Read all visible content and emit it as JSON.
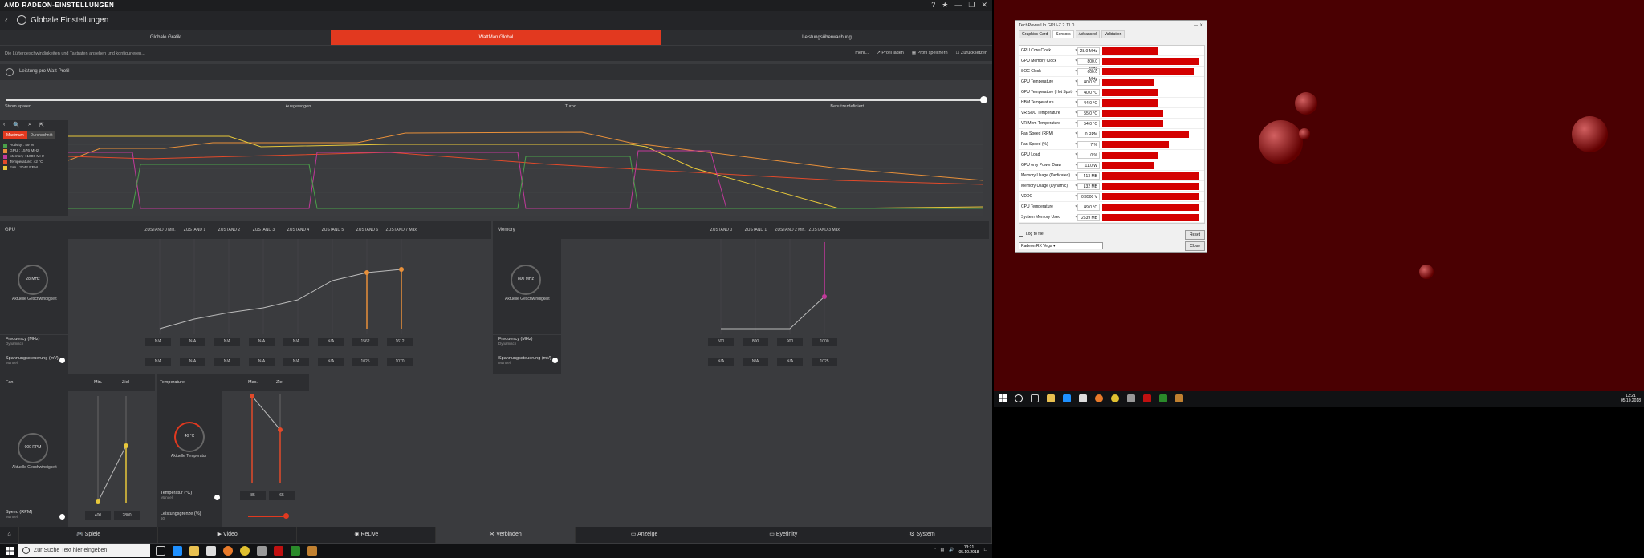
{
  "radeon": {
    "brand": "AMD RADEON-EINSTELLUNGEN",
    "title": "Globale Einstellungen",
    "tabs": [
      "Globale Grafik",
      "WattMan Global",
      "Leistungsüberwachung"
    ],
    "description": "Die Lüftergeschwindigkeiten und Taktraten ansehen und konfigurieren...",
    "actions": [
      "mehr...",
      "Profil laden",
      "Profil speichern",
      "Zurücksetzen"
    ],
    "profile_label": "Leistung pro Watt-Profil",
    "preset_labels": [
      "Strom sparen",
      "Ausgewogen",
      "Turbo",
      "Benutzerdefiniert"
    ],
    "graph_buttons": [
      "Maximum",
      "Durchschnitt"
    ],
    "legend": [
      {
        "label": "Activity : 49 %",
        "color": "#4aa04a"
      },
      {
        "label": "GPU : 1576 MHz",
        "color": "#e8903a"
      },
      {
        "label": "Memory : 1000 MHz",
        "color": "#c0399a"
      },
      {
        "label": "Temperature: 42 °C",
        "color": "#e24a2a"
      },
      {
        "label": "Fan : 3042 RPM",
        "color": "#e8c83a"
      }
    ],
    "gpu": {
      "section": "GPU",
      "states": [
        "ZUSTAND 0 Min.",
        "ZUSTAND 1",
        "ZUSTAND 2",
        "ZUSTAND 3",
        "ZUSTAND 4",
        "ZUSTAND 5",
        "ZUSTAND 6",
        "ZUSTAND 7 Max."
      ],
      "gauge": "28 MHz",
      "gauge_label": "Aktuelle Geschwindigkeit",
      "freq_label": "Frequency (MHz)",
      "freq_sub": "Dynamisch",
      "freq_values": [
        "N/A",
        "N/A",
        "N/A",
        "N/A",
        "N/A",
        "N/A",
        "1562",
        "1612"
      ],
      "volt_label": "Spannungssteuerung (mV)",
      "volt_sub": "Manuell",
      "volt_values": [
        "N/A",
        "N/A",
        "N/A",
        "N/A",
        "N/A",
        "N/A",
        "1025",
        "1070"
      ]
    },
    "memory": {
      "section": "Memory",
      "states": [
        "ZUSTAND 0",
        "ZUSTAND 1",
        "ZUSTAND 2 Min.",
        "ZUSTAND 3 Max."
      ],
      "gauge": "800 MHz",
      "gauge_label": "Aktuelle Geschwindigkeit",
      "freq_label": "Frequency (MHz)",
      "freq_sub": "Dynamisch",
      "freq_values": [
        "500",
        "800",
        "900",
        "1000"
      ],
      "volt_label": "Spannungssteuerung (mV)",
      "volt_sub": "Manuell",
      "volt_values": [
        "N/A",
        "N/A",
        "N/A",
        "1025"
      ]
    },
    "fan": {
      "section": "Fan",
      "cols": [
        "Min.",
        "Ziel"
      ],
      "gauge": "000 RPM",
      "gauge_label": "Aktuelle Geschwindigkeit",
      "speed_label": "Speed (RPM)",
      "speed_sub": "Manuell",
      "speed_values": [
        "400",
        "2800"
      ]
    },
    "temperature": {
      "section": "Temperature",
      "cols": [
        "Max.",
        "Ziel"
      ],
      "gauge": "40 °C",
      "gauge_label": "Aktuelle Temperatur",
      "temp_label": "Temperatur (°C)",
      "temp_sub": "Manuell",
      "temp_values": [
        "85",
        "65"
      ],
      "power_label": "Leistungsgrenze (%)",
      "power_sub": "50"
    },
    "bottom_nav": [
      "Spiele",
      "Video",
      "ReLive",
      "Verbinden",
      "Anzeige",
      "Eyefinity",
      "System"
    ]
  },
  "taskbar_left": {
    "search_placeholder": "Zur Suche Text hier eingeben",
    "time": "13:21",
    "date": "05.10.2018"
  },
  "gpuz": {
    "title": "TechPowerUp GPU-Z 2.11.0",
    "tabs": [
      "Graphics Card",
      "Sensors",
      "Advanced",
      "Validation"
    ],
    "rows": [
      {
        "name": "GPU Core Clock",
        "value": "28.0 MHz",
        "fill": 0.55
      },
      {
        "name": "GPU Memory Clock",
        "value": "800.0 MHz",
        "fill": 0.95
      },
      {
        "name": "SOC Clock",
        "value": "600.0 MHz",
        "fill": 0.9
      },
      {
        "name": "GPU Temperature",
        "value": "40.0 °C",
        "fill": 0.5
      },
      {
        "name": "GPU Temperature (Hot Spot)",
        "value": "40.0 °C",
        "fill": 0.55
      },
      {
        "name": "HBM Temperature",
        "value": "44.0 °C",
        "fill": 0.55
      },
      {
        "name": "VR SOC Temperature",
        "value": "55.0 °C",
        "fill": 0.6
      },
      {
        "name": "VR Mem Temperature",
        "value": "54.0 °C",
        "fill": 0.6
      },
      {
        "name": "Fan Speed (RPM)",
        "value": "0 RPM",
        "fill": 0.85
      },
      {
        "name": "Fan Speed (%)",
        "value": "7 %",
        "fill": 0.65
      },
      {
        "name": "GPU Load",
        "value": "0 %",
        "fill": 0.55
      },
      {
        "name": "GPU only Power Draw",
        "value": "11.0 W",
        "fill": 0.5
      },
      {
        "name": "Memory Usage (Dedicated)",
        "value": "413 MB",
        "fill": 0.95
      },
      {
        "name": "Memory Usage (Dynamic)",
        "value": "132 MB",
        "fill": 0.95
      },
      {
        "name": "VDDC",
        "value": "0.9500 V",
        "fill": 0.95
      },
      {
        "name": "CPU Temperature",
        "value": "49.0 °C",
        "fill": 0.95
      },
      {
        "name": "System Memory Used",
        "value": "2539 MB",
        "fill": 0.95
      }
    ],
    "log_label": "Log to file",
    "reset_label": "Reset",
    "device": "Radeon RX Vega",
    "close_label": "Close"
  },
  "taskbar_right": {
    "time": "13:21",
    "date": "05.10.2018"
  },
  "colors": {
    "accent": "#e2391f",
    "gpu_line": "#e8903a",
    "mem_line": "#c0399a",
    "fan_line": "#e8c83a",
    "temp_line": "#e24a2a"
  }
}
